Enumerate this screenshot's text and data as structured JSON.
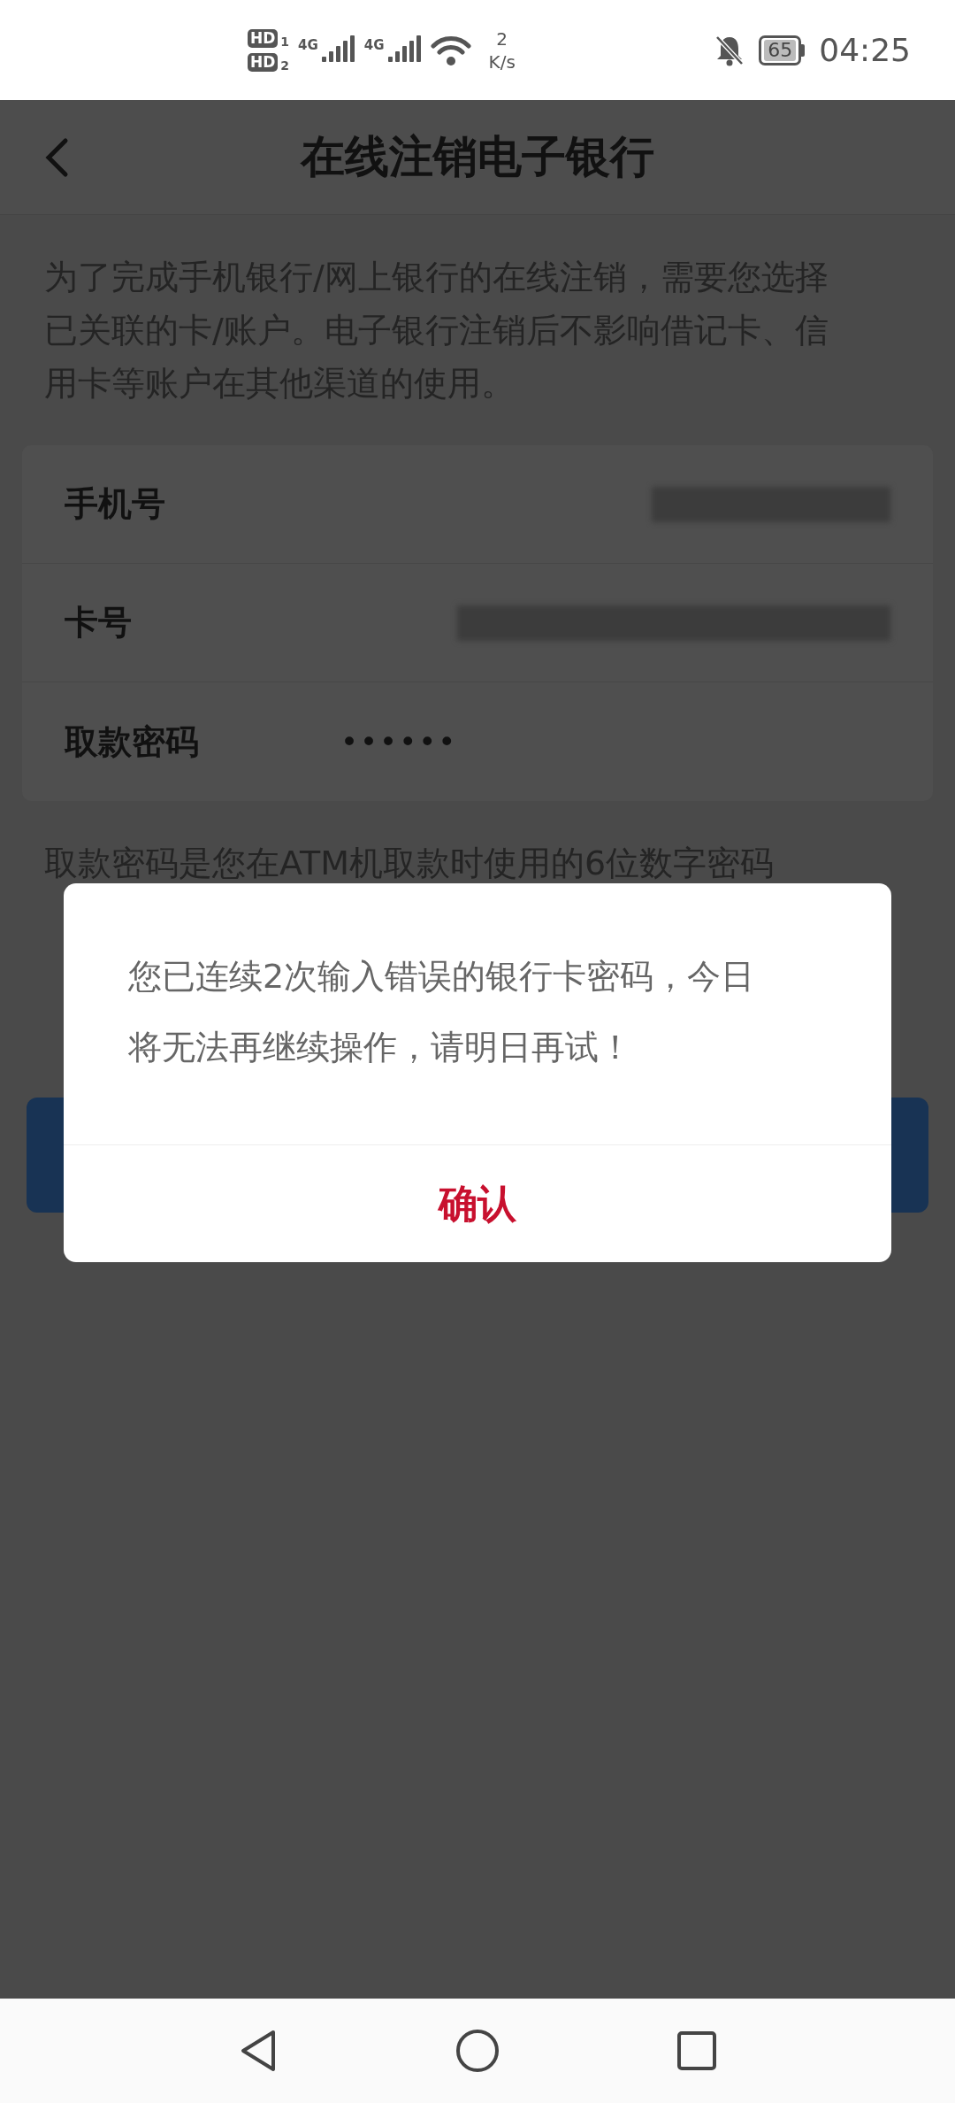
{
  "status_bar": {
    "sims": [
      {
        "badge": "HD",
        "slot": "1",
        "network": "4G"
      },
      {
        "badge": "HD",
        "slot": "2",
        "network": "4G"
      }
    ],
    "speed_value": "2",
    "speed_unit": "K/s",
    "battery": "65",
    "time": "04:25"
  },
  "header": {
    "title": "在线注销电子银行"
  },
  "description": "为了完成手机银行/网上银行的在线注销，需要您选择已关联的卡/账户。电子银行注销后不影响借记卡、信用卡等账户在其他渠道的使用。",
  "form": [
    {
      "kind": "blurred",
      "label": "手机号"
    },
    {
      "kind": "blurred",
      "label": "卡号"
    },
    {
      "kind": "password",
      "label": "取款密码",
      "value": "••••••"
    }
  ],
  "hint_lines": [
    "取款密码是您在ATM机取款时使用的6位数字密码"
  ],
  "dialog": {
    "message": "您已连续2次输入错误的银行卡密码，今日将无法再继续操作，请明日再试！",
    "confirm": "确认"
  }
}
